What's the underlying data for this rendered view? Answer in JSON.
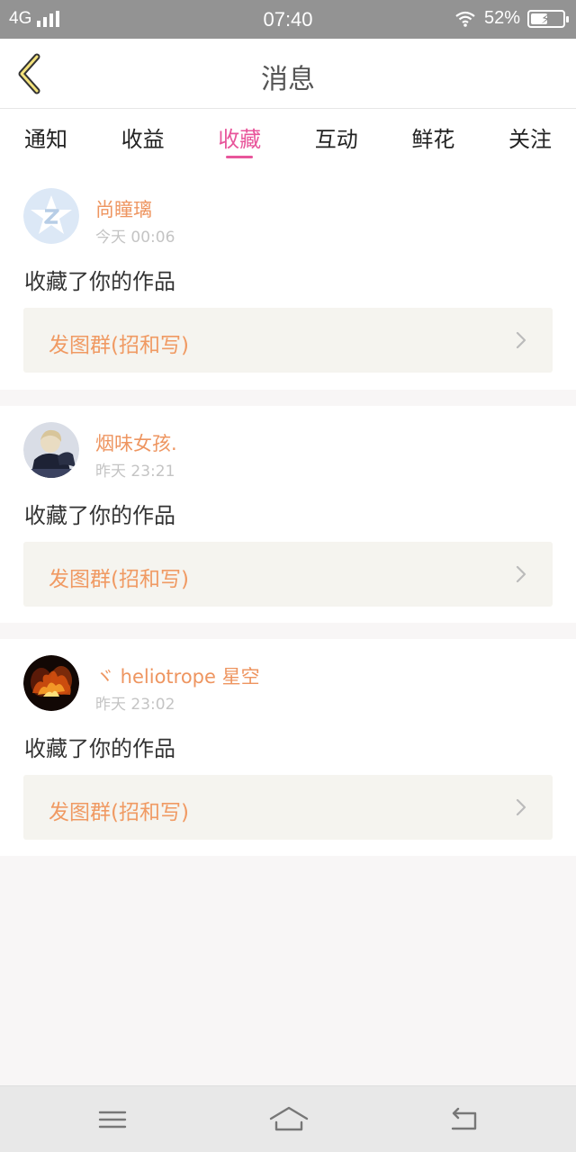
{
  "status_bar": {
    "network": "4G",
    "time": "07:40",
    "battery": "52%",
    "battery_level": 0.52
  },
  "header": {
    "title": "消息",
    "back_icon": "chevron-left-icon"
  },
  "tabs": [
    {
      "label": "通知",
      "active": false
    },
    {
      "label": "收益",
      "active": false
    },
    {
      "label": "收藏",
      "active": true
    },
    {
      "label": "互动",
      "active": false
    },
    {
      "label": "鲜花",
      "active": false
    },
    {
      "label": "关注",
      "active": false
    }
  ],
  "messages": [
    {
      "username": "尚瞳璃",
      "time": "今天 00:06",
      "action": "收藏了你的作品",
      "work": "发图群(招和写)"
    },
    {
      "username": "烟味女孩.",
      "time": "昨天 23:21",
      "action": "收藏了你的作品",
      "work": "发图群(招和写)"
    },
    {
      "username": "ヾ heliotrope 星空",
      "time": "昨天 23:02",
      "action": "收藏了你的作品",
      "work": "发图群(招和写)"
    }
  ],
  "nav_bar": {
    "items": [
      "menu-icon",
      "home-icon",
      "back-icon"
    ]
  },
  "colors": {
    "accent": "#e8559b",
    "username": "#ee9560",
    "work_link": "#f09a63",
    "status_bar": "#939393"
  }
}
